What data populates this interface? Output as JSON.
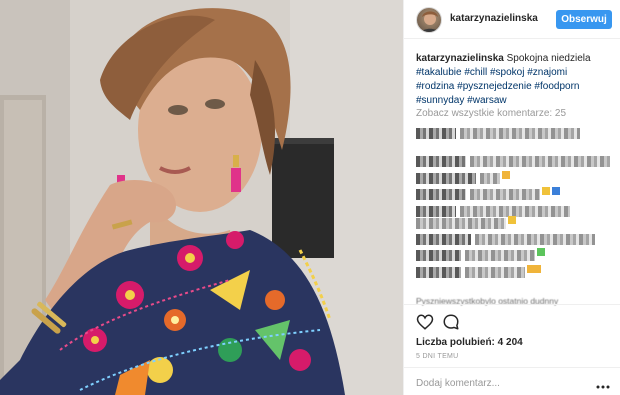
{
  "post": {
    "username": "katarzynazielinska",
    "follow_label": "Obserwuj",
    "caption_user": "katarzynazielinska",
    "caption_text": "Spokojna niedziela",
    "hashtags": [
      "#takalubie",
      "#chill",
      "#spokoj",
      "#znajomi",
      "#rodzina",
      "#pysznejedzenie",
      "#foodporn",
      "#sunnyday",
      "#warsaw"
    ],
    "view_all_comments": "Zobacz wszystkie komentarze: 25",
    "likes": "Liczba polubień: 4 204",
    "timestamp": "5 DNI TEMU",
    "comment_placeholder": "Dodaj komentarz...",
    "last_comment_partial": "Pyszniewszystkobylo ostatnio dudnny"
  },
  "icons": {
    "avatar": "avatar",
    "like": "heart-icon",
    "comment": "comment-bubble-icon",
    "more": "more-options-icon"
  },
  "colors": {
    "follow_button": "#3897f0",
    "hashtag": "#003569",
    "muted": "#999999",
    "text": "#262626"
  }
}
